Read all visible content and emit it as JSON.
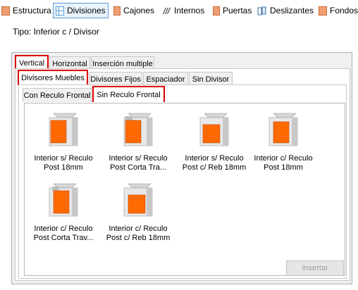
{
  "toolbar": {
    "items": [
      {
        "label": "Estructura",
        "icon": "estructura-icon"
      },
      {
        "label": "Divisiones",
        "icon": "divisiones-icon"
      },
      {
        "label": "Cajones",
        "icon": "cajones-icon"
      },
      {
        "label": "Internos",
        "icon": "internos-icon"
      },
      {
        "label": "Puertas",
        "icon": "puertas-icon"
      },
      {
        "label": "Deslizantes",
        "icon": "deslizantes-icon"
      },
      {
        "label": "Fondos",
        "icon": "fondos-icon"
      }
    ],
    "active_index": 1
  },
  "tipo": "Tipo: Inferior c / Divisor",
  "tabs_level1": [
    "Vertical",
    "Horizontal",
    "Inserción multiple"
  ],
  "tabs_level2": [
    "Divisores Muebles",
    "Divisores Fijos",
    "Espaciador",
    "Sin Divisor"
  ],
  "tabs_level3": [
    "Con Reculo Frontal",
    "Sin Reculo Frontal"
  ],
  "items": [
    {
      "line1": "Interior s/ Reculo",
      "line2": "Post 18mm"
    },
    {
      "line1": "Interior s/ Reculo",
      "line2": "Post Corta Tra..."
    },
    {
      "line1": "Interior s/ Reculo",
      "line2": "Post c/ Reb 18mm"
    },
    {
      "line1": "Interior c/ Reculo",
      "line2": "Post 18mm"
    },
    {
      "line1": "Interior c/ Reculo",
      "line2": "Post Corta Trav..."
    },
    {
      "line1": "Interior c/ Reculo",
      "line2": "Post c/ Reb 18mm"
    }
  ],
  "insertar_label": "Insertar",
  "colors": {
    "accent": "#ff6a00",
    "selection": "#dd0000"
  }
}
